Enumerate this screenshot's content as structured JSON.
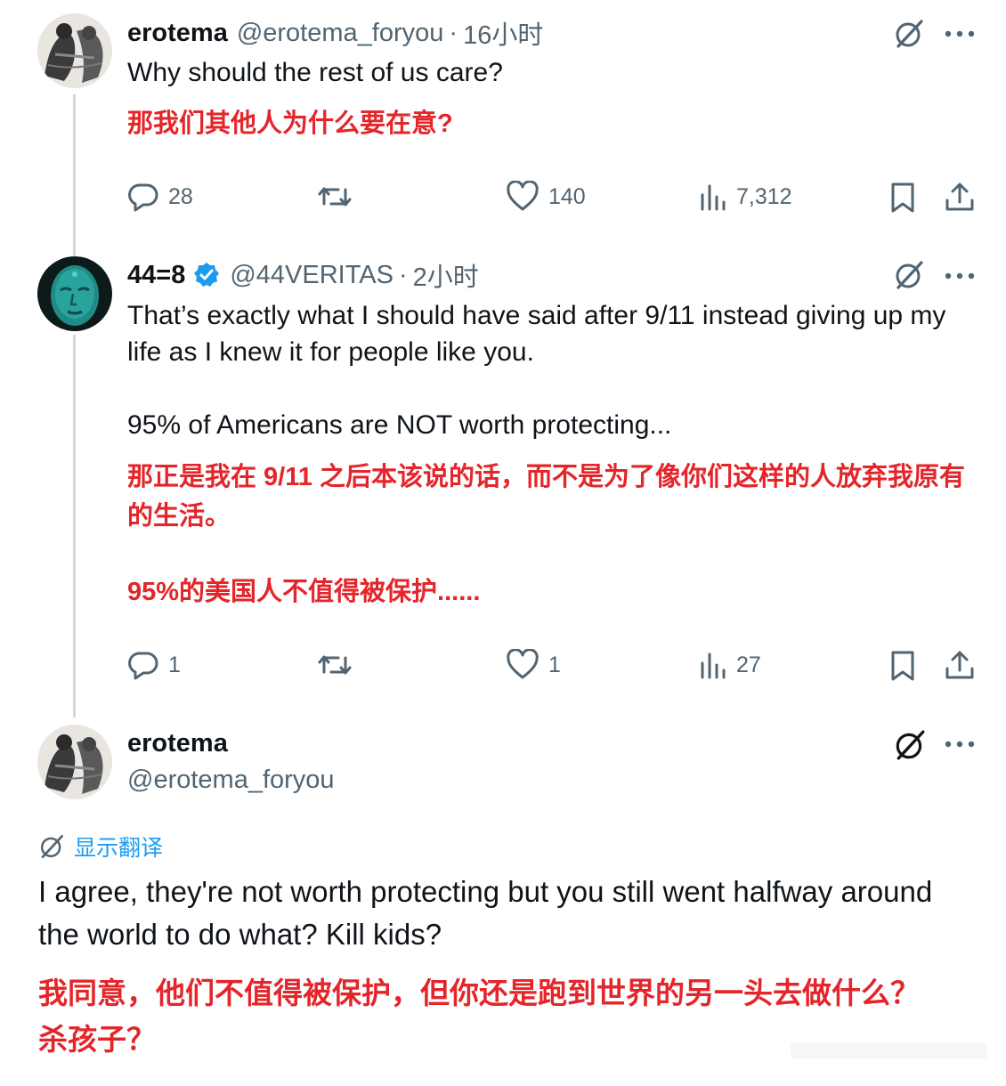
{
  "tweets": [
    {
      "name": "erotema",
      "handle": "@erotema_foryou",
      "time": "16小时",
      "text_en": "Why should the rest of us care?",
      "text_zh": "那我们其他人为什么要在意?",
      "replies": "28",
      "retweets": "",
      "likes": "140",
      "views": "7,312"
    },
    {
      "name": "44=8",
      "verified": true,
      "handle": "@44VERITAS",
      "time": "2小时",
      "text_en_1": "That’s exactly what I should have said after 9/11 instead giving up my life as I knew it for people like you.",
      "text_en_2": "95% of Americans are NOT worth protecting...",
      "text_zh_1": "那正是我在 9/11 之后本该说的话，而不是为了像你们这样的人放弃我原有的生活。",
      "text_zh_2": "95%的美国人不值得被保护......",
      "replies": "1",
      "retweets": "",
      "likes": "1",
      "views": "27"
    },
    {
      "name": "erotema",
      "handle": "@erotema_foryou",
      "translate_label": "显示翻译",
      "text_en": "I agree, they're not worth protecting but you still went halfway around the world to do what? Kill kids?",
      "text_zh": "我同意，他们不值得被保护，但你还是跑到世界的另一头去做什么？杀孩子？"
    }
  ],
  "icons": {
    "reply": "reply-icon",
    "retweet": "retweet-icon",
    "like": "heart-icon",
    "views": "views-icon",
    "bookmark": "bookmark-icon",
    "share": "share-icon",
    "grok": "grok-icon",
    "more": "more-icon",
    "verified": "verified-badge-icon"
  },
  "colors": {
    "text": "#0f1419",
    "secondary": "#536471",
    "accent": "#1d9bf0",
    "annotation_red": "#e4252a",
    "thread_line": "#cfd9de"
  }
}
